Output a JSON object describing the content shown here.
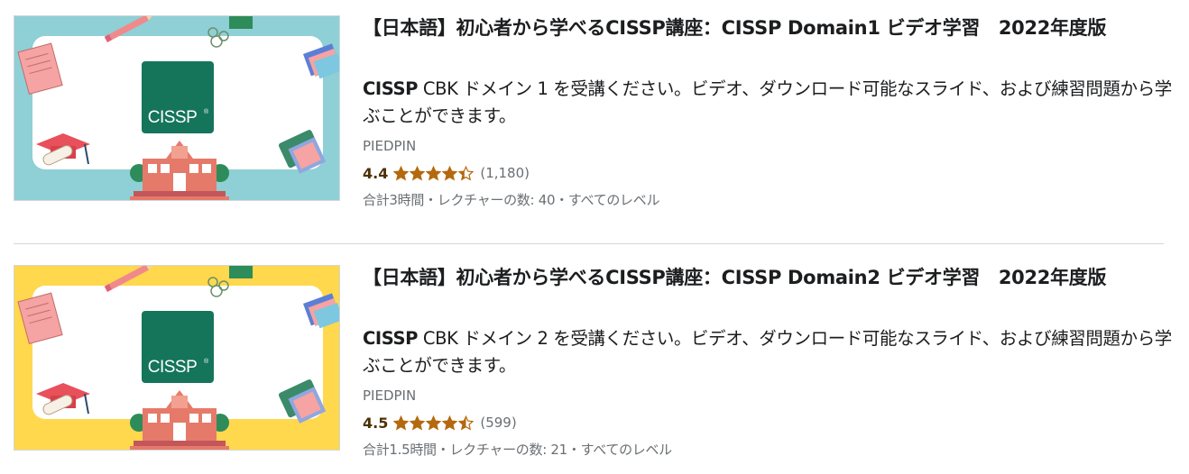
{
  "colors": {
    "thumb_bg_1": "#8fcfd6",
    "thumb_bg_2": "#ffd84d",
    "cissp_green": "#14755a",
    "star": "#b4690e",
    "rating_text": "#4d3105",
    "muted_text": "#6a6f73"
  },
  "courses": [
    {
      "thumbnail": {
        "logo_text": "CISSP",
        "mark": "®"
      },
      "title": "【日本語】初心者から学べるCISSP講座：CISSP Domain1 ビデオ学習　2022年度版",
      "desc_prefix": "CISSP",
      "desc_rest": " CBK ドメイン 1 を受講ください。ビデオ、ダウンロード可能なスライド、および練習問題から学ぶことができます。",
      "instructor": "PIEDPIN",
      "rating": "4.4",
      "rating_value": 4.4,
      "rating_count": "(1,180)",
      "meta": "合計3時間・レクチャーの数: 40・すべてのレベル"
    },
    {
      "thumbnail": {
        "logo_text": "CISSP",
        "mark": "®"
      },
      "title": "【日本語】初心者から学べるCISSP講座：CISSP Domain2 ビデオ学習　2022年度版",
      "desc_prefix": "CISSP",
      "desc_rest": " CBK ドメイン 2 を受講ください。ビデオ、ダウンロード可能なスライド、および練習問題から学ぶことができます。",
      "instructor": "PIEDPIN",
      "rating": "4.5",
      "rating_value": 4.5,
      "rating_count": "(599)",
      "meta": "合計1.5時間・レクチャーの数: 21・すべてのレベル"
    }
  ]
}
